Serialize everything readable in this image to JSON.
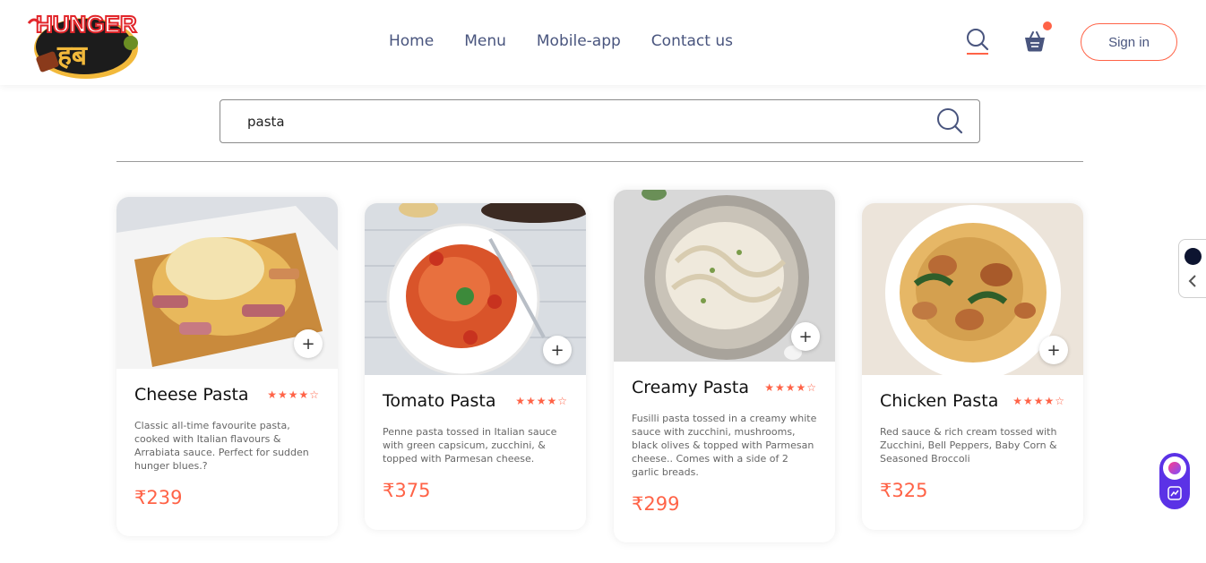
{
  "brand": {
    "logo_text": "HUNGER हब",
    "colors": {
      "accent": "#ff6347",
      "nav_text": "#49557e"
    }
  },
  "nav": {
    "items": [
      {
        "label": "Home"
      },
      {
        "label": "Menu"
      },
      {
        "label": "Mobile-app"
      },
      {
        "label": "Contact us"
      }
    ]
  },
  "header_actions": {
    "search_icon": "search-icon",
    "cart_icon": "basket-icon",
    "signin_label": "Sign in"
  },
  "search": {
    "value": "pasta",
    "button_icon": "search-icon"
  },
  "cards": [
    {
      "name": "Cheese Pasta",
      "rating": 4,
      "rating_max": 5,
      "description": "Classic all-time favourite pasta, cooked with Italian flavours & Arrabiata sauce. Perfect for sudden hunger blues.?",
      "price": "₹239"
    },
    {
      "name": "Tomato Pasta",
      "rating": 4,
      "rating_max": 5,
      "description": "Penne pasta tossed in Italian sauce with green capsicum, zucchini, & topped with Parmesan cheese.",
      "price": "₹375"
    },
    {
      "name": "Creamy Pasta",
      "rating": 4,
      "rating_max": 5,
      "description": "Fusilli pasta tossed in a creamy white sauce with zucchini, mushrooms, black olives & topped with Parmesan cheese.. Comes with a side of 2 garlic breads.",
      "price": "₹299"
    },
    {
      "name": "Chicken Pasta",
      "rating": 4,
      "rating_max": 5,
      "description": "Red sauce & rich cream tossed with Zucchini, Bell Peppers, Baby Corn & Seasoned Broccoli",
      "price": "₹325"
    }
  ],
  "stars_text": "★★★★☆",
  "add_label": "+"
}
